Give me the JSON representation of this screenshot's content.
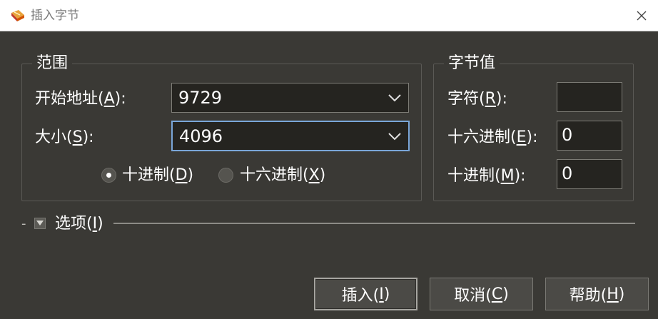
{
  "window": {
    "title": "插入字节",
    "close_glyph": "✕"
  },
  "range_group": {
    "title": "范围",
    "start_address": {
      "label_pre": "开始地址(",
      "label_key": "A",
      "label_post": "):",
      "value": "9729"
    },
    "size": {
      "label_pre": "大小(",
      "label_key": "S",
      "label_post": "):",
      "value": "4096"
    },
    "radix": {
      "decimal": {
        "label_pre": "十进制(",
        "label_key": "D",
        "label_post": ")",
        "checked": true
      },
      "hex": {
        "label_pre": "十六进制(",
        "label_key": "X",
        "label_post": ")",
        "checked": false
      }
    }
  },
  "byte_value_group": {
    "title": "字节值",
    "char": {
      "label_pre": "字符(",
      "label_key": "R",
      "label_post": "):",
      "value": ""
    },
    "hex": {
      "label_pre": "十六进制(",
      "label_key": "E",
      "label_post": "):",
      "value": "0"
    },
    "dec": {
      "label_pre": "十进制(",
      "label_key": "M",
      "label_post": "):",
      "value": "0"
    }
  },
  "options": {
    "dash": "-",
    "label_pre": "选项(",
    "label_key": "I",
    "label_post": ")"
  },
  "buttons": {
    "insert": {
      "label_pre": "插入(",
      "label_key": "I",
      "label_post": ")"
    },
    "cancel": {
      "label_pre": "取消(",
      "label_key": "C",
      "label_post": ")"
    },
    "help": {
      "label_pre": "帮助(",
      "label_key": "H",
      "label_post": ")"
    }
  },
  "colors": {
    "background": "#3a3935",
    "field_bg": "#252420",
    "focus_border": "#7aa6d8",
    "title_text": "#7a7a7a"
  },
  "icons": {
    "app": "hex-editor-app-icon",
    "dropdown": "chevron-down-icon",
    "expander": "collapse-triangle-icon"
  }
}
